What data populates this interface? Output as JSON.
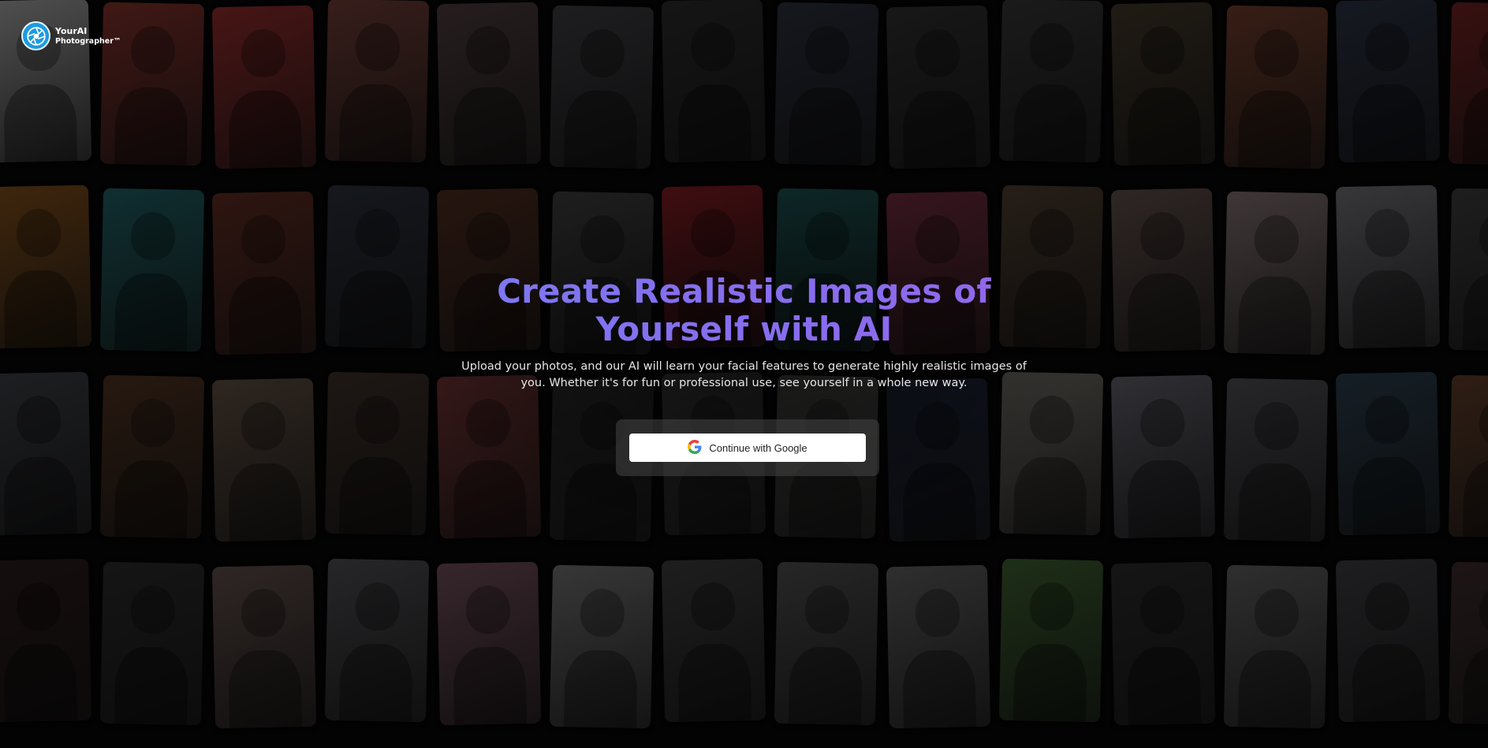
{
  "brand": {
    "name": "YourAI",
    "tagline": "Photographer™",
    "icon": "camera-aperture-icon",
    "color": "#1c9be0"
  },
  "hero": {
    "title_line1": "Create Realistic Images of",
    "title_line2": "Yourself with AI",
    "subtitle_line1": "Upload your photos, and our AI will learn your facial features to generate highly realistic images of",
    "subtitle_line2": "you. Whether it's for fun or professional use, see yourself in a whole new way.",
    "gradient_start": "#6f8ff7",
    "gradient_end": "#a35ce8"
  },
  "auth": {
    "google_label": "Continue with Google",
    "google_icon": "google-g-icon"
  },
  "gallery": {
    "rows": [
      [
        "#9a9a9a",
        "#7a2f2a",
        "#8a2a2a",
        "#6a3a34",
        "#4a3a3a",
        "#3a3a3e",
        "#2a2a2a",
        "#2a2e3a",
        "#2e2e2e",
        "#333333",
        "#3e3428",
        "#6a3a2a",
        "#2a3040",
        "#6a2020"
      ],
      [
        "#7a4a1a",
        "#1f5a5e",
        "#5a2a20",
        "#2a2e38",
        "#4a2a1e",
        "#3a3a3a",
        "#7a1a20",
        "#1a4a4a",
        "#6a2a3a",
        "#4a3a2e",
        "#5a4a46",
        "#7a6a6a",
        "#6a6a70",
        "#3a3a3a"
      ],
      [
        "#3a3c42",
        "#4a3020",
        "#5a4a3e",
        "#3a2e28",
        "#6a3030",
        "#2a2a2a",
        "#3a3a3a",
        "#4a4a48",
        "#1e2438",
        "#6a6660",
        "#5a5a64",
        "#4a4a50",
        "#2a3a48",
        "#5a3a28"
      ],
      [
        "#2a1a1a",
        "#2a2a2a",
        "#5a4a46",
        "#4a4a4e",
        "#6a4a56",
        "#6a6a6a",
        "#3a3a3a",
        "#4a4a4a",
        "#5a5a5a",
        "#3a5a2e",
        "#2a2a2a",
        "#5a5a5a",
        "#3a3a3e",
        "#3a2a2a"
      ]
    ]
  }
}
